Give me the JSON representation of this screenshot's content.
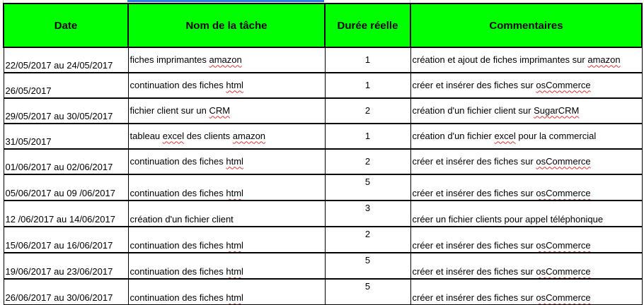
{
  "headers": {
    "date": "Date",
    "task": "Nom de la tâche",
    "duration": "Durée réelle",
    "comments": "Commentaires"
  },
  "rows": [
    {
      "date": "22/05/2017 au 24/05/2017",
      "task": [
        "fiches imprimantes ",
        "amazon"
      ],
      "duration": "1",
      "comment": [
        "création et ajout de fiches imprimantes sur ",
        "amazon"
      ]
    },
    {
      "date": "26/05/2017",
      "task": [
        "continuation des fiches ",
        "html"
      ],
      "duration": "1",
      "comment": [
        "créer et insérer des fiches sur ",
        "osCommerce"
      ]
    },
    {
      "date": "29/05/2017 au 30/05/2017",
      "task": [
        "fichier client sur un ",
        "CRM"
      ],
      "duration": "2",
      "comment": [
        "création d'un fichier client sur ",
        "SugarCRM"
      ]
    },
    {
      "date": "31/05/2017",
      "task": [
        "tableau ",
        "excel",
        " des clients ",
        "amazon"
      ],
      "duration": "1",
      "comment": [
        "création d'un fichier ",
        "excel",
        " pour la commercial"
      ]
    },
    {
      "date": "01/06/2017 au 02/06/2017",
      "task": [
        "continuation des fiches ",
        "html"
      ],
      "duration": "2",
      "comment": [
        "créer et insérer des fiches sur ",
        "osCommerce"
      ]
    },
    {
      "date": "05/06/2017 au 09 /06/2017",
      "task": [
        "continuation des fiches ",
        "html"
      ],
      "duration": "5",
      "comment": [
        "créer et insérer des fiches sur ",
        "osCommerce"
      ]
    },
    {
      "date": "12 /06/2017 au 14/06/2017",
      "task": [
        "création d'un fichier client"
      ],
      "duration": "3",
      "comment": [
        "créer un fichier clients pour appel téléphonique"
      ]
    },
    {
      "date": "15/06/2017 au 16/06/2017",
      "task": [
        "continuation des fiches ",
        "html"
      ],
      "duration": "2",
      "comment": [
        "créer et insérer des fiches sur ",
        "osCommerce"
      ]
    },
    {
      "date": "19/06/2017 au 23/06/2017",
      "task": [
        "continuation des fiches ",
        "html"
      ],
      "duration": "5",
      "comment": [
        "créer et insérer des fiches sur ",
        "osCommerce"
      ]
    },
    {
      "date": "26/06/2017 au 30/06/2017",
      "task": [
        "continuation des fiches ",
        "html"
      ],
      "duration": "5",
      "comment": [
        "créer et insérer des fiches sur ",
        "osCommerce"
      ]
    }
  ],
  "colors": {
    "header_bg": "#00ff00",
    "selection": "#2e7de0",
    "spellcheck": "#e23030"
  }
}
